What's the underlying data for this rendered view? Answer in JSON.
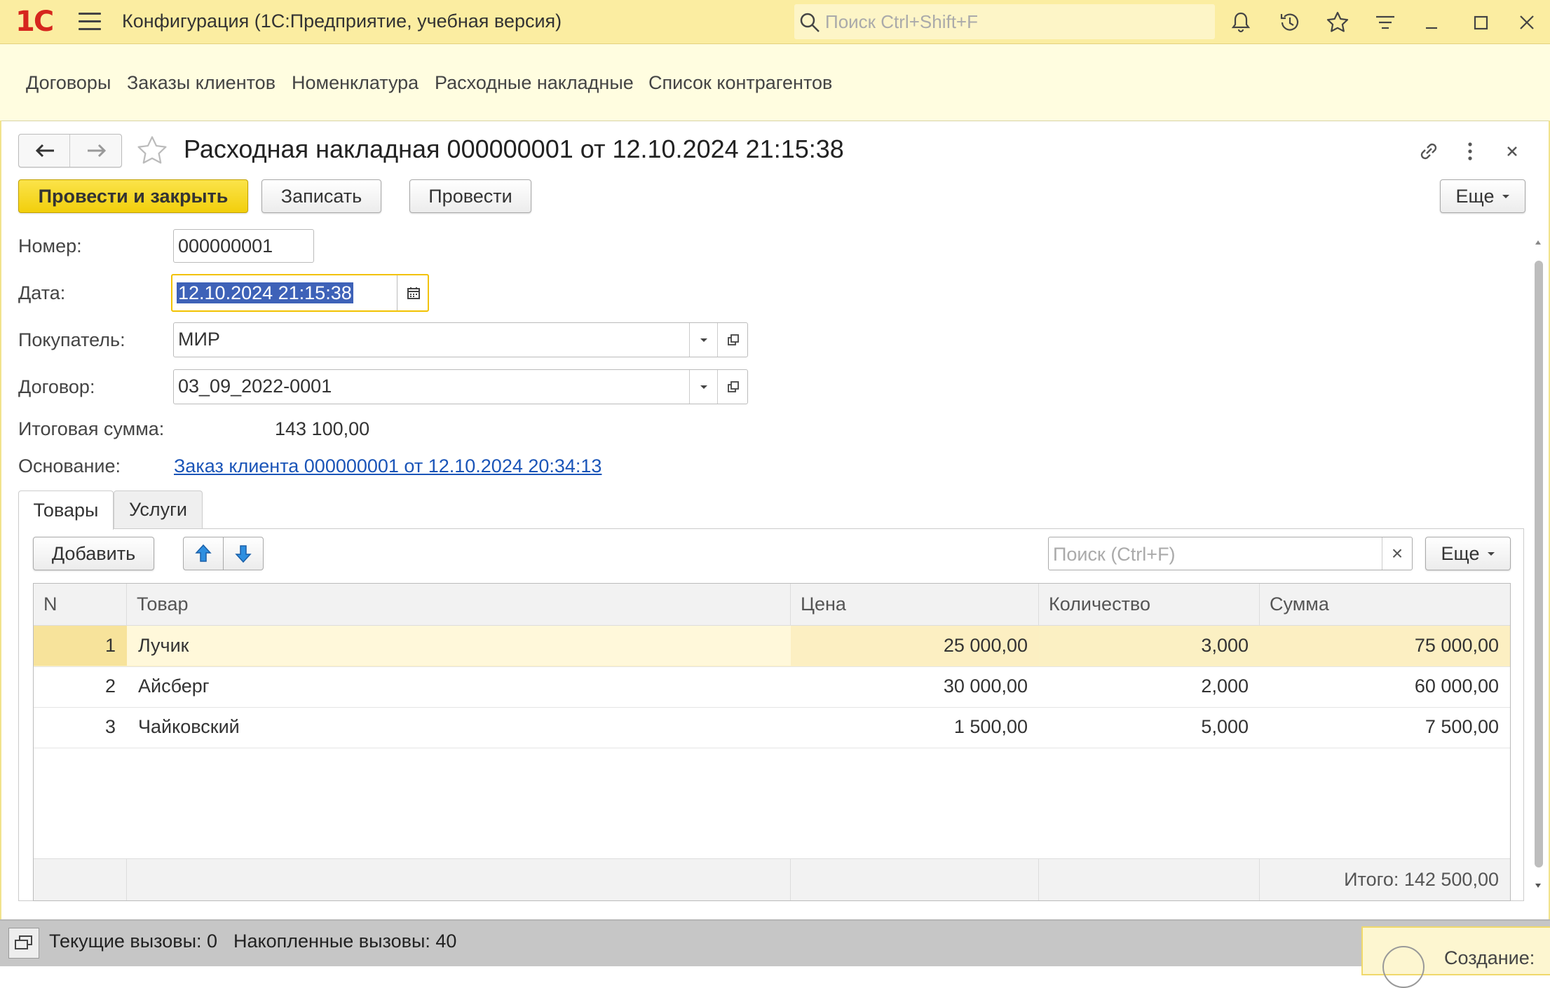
{
  "app": {
    "logo_text": "1С",
    "title": "Конфигурация  (1С:Предприятие, учебная версия)",
    "search_placeholder": "Поиск Ctrl+Shift+F"
  },
  "sections": [
    "Договоры",
    "Заказы клиентов",
    "Номенклатура",
    "Расходные накладные",
    "Список контрагентов"
  ],
  "form": {
    "title": "Расходная накладная 000000001 от 12.10.2024 21:15:38",
    "buttons": {
      "post_close": "Провести и закрыть",
      "save": "Записать",
      "post": "Провести",
      "more": "Еще"
    },
    "fields": {
      "number_label": "Номер:",
      "number_value": "000000001",
      "date_label": "Дата:",
      "date_value": "12.10.2024 21:15:38",
      "buyer_label": "Покупатель:",
      "buyer_value": "МИР",
      "contract_label": "Договор:",
      "contract_value": "03_09_2022-0001",
      "total_label": "Итоговая сумма:",
      "total_value": "143 100,00",
      "basis_label": "Основание:",
      "basis_link": "Заказ клиента 000000001 от 12.10.2024 20:34:13"
    },
    "tabs": [
      "Товары",
      "Услуги"
    ],
    "table_toolbar": {
      "add": "Добавить",
      "search_placeholder": "Поиск (Ctrl+F)",
      "clear": "×",
      "more": "Еще"
    },
    "table": {
      "columns": [
        "N",
        "Товар",
        "Цена",
        "Количество",
        "Сумма"
      ],
      "rows": [
        {
          "n": "1",
          "item": "Лучик",
          "price": "25 000,00",
          "qty": "3,000",
          "sum": "75 000,00"
        },
        {
          "n": "2",
          "item": "Айсберг",
          "price": "30 000,00",
          "qty": "2,000",
          "sum": "60 000,00"
        },
        {
          "n": "3",
          "item": "Чайковский",
          "price": "1 500,00",
          "qty": "5,000",
          "sum": "7 500,00"
        }
      ],
      "footer_total": "Итого: 142 500,00"
    }
  },
  "status": {
    "current_calls": "Текущие вызовы: 0",
    "accumulated_calls": "Накопленные вызовы: 40",
    "popup_text": "Создание:"
  },
  "colors": {
    "titlebar": "#fbeda1",
    "sections_bg": "#fffde0",
    "primary_button": "#f2cf0c",
    "link": "#1b55b8",
    "selected_row": "#fbf0c3",
    "logo": "#d6261e"
  }
}
